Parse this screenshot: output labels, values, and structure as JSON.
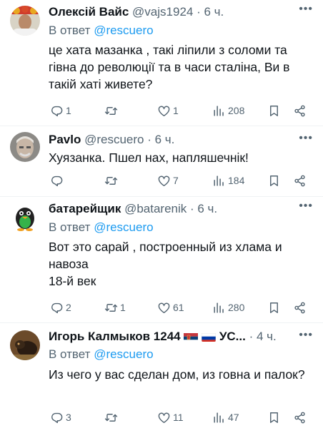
{
  "tweets": [
    {
      "name": "Олексій Вайс",
      "handle": "@vajs1924",
      "time": "· 6 ч.",
      "reply_prefix": "В ответ",
      "reply_to": "@rescuero",
      "text": "це хата мазанка , такі ліпили з соломи та гівна до революції та в часи сталіна, Ви в такій хаті живете?",
      "replies": "1",
      "retweets": "",
      "likes": "1",
      "views": "208"
    },
    {
      "name": "Pavlo",
      "handle": "@rescuero",
      "time": "· 6 ч.",
      "text": "Хуязанка. Пшел нах, напляшечнік!",
      "replies": "",
      "retweets": "",
      "likes": "7",
      "views": "184"
    },
    {
      "name": "батарейщик",
      "handle": "@batarenik",
      "time": "· 6 ч.",
      "reply_prefix": "В ответ",
      "reply_to": "@rescuero",
      "text": "Вот это сарай , построенный из хлама и навоза\n18-й век",
      "replies": "2",
      "retweets": "1",
      "likes": "61",
      "views": "280"
    },
    {
      "name": "Игорь Калмыков 1244",
      "name_suffix": "УС...",
      "time": "· 4 ч.",
      "reply_prefix": "В ответ",
      "reply_to": "@rescuero",
      "text": "Из чего у вас сделан дом, из говна и палок?",
      "replies": "3",
      "retweets": "",
      "likes": "11",
      "views": "47"
    }
  ],
  "icons": {
    "reply": "reply-icon",
    "retweet": "retweet-icon",
    "like": "heart-icon",
    "views": "views-icon",
    "bookmark": "bookmark-icon",
    "share": "share-icon",
    "more": "more-icon"
  },
  "colors": {
    "text": "#0f1419",
    "muted": "#536471",
    "link": "#1d9bf0",
    "separator": "#eff3f4",
    "thread_line": "#cfd9de"
  }
}
